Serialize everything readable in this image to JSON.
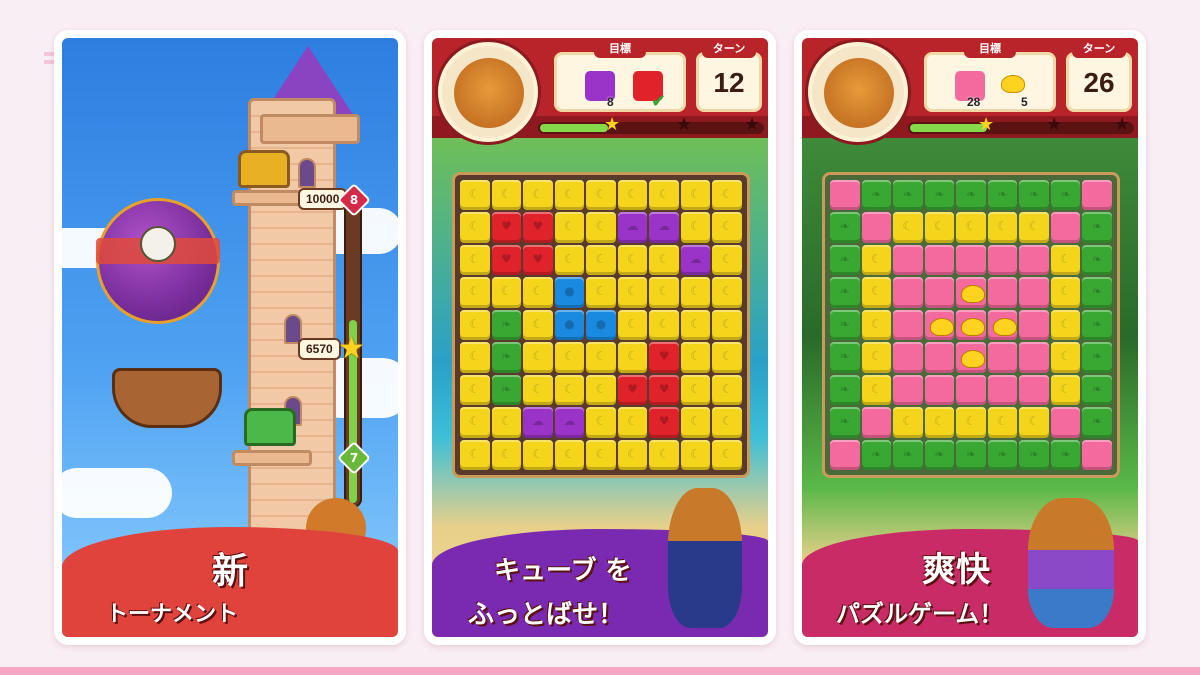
{
  "colors": {
    "page_bg": "#f8eef3",
    "card_frame": "#ffffff",
    "red_banner": "#e0423c",
    "purple_banner": "#7a2ab0",
    "pink_banner": "#c82b66",
    "header_red": "#b8242a"
  },
  "cards": [
    {
      "id": "tournament",
      "headline_line1": "新",
      "headline_line2": "トーナメント",
      "tower_scores": [
        "10000",
        "6570"
      ],
      "tier_badges": [
        "8",
        "7"
      ],
      "tournament_progress": 0.58
    },
    {
      "id": "cube-blast",
      "goal_label": "目標",
      "turns_label": "ターン",
      "turns_value": "12",
      "goals": [
        {
          "item": "purple-cube-icon",
          "count": "8"
        },
        {
          "item": "red-cube-icon",
          "count": ""
        }
      ],
      "goal_complete_icon": "check-icon",
      "star_progress": 0.3,
      "board": [
        "YYYYYYYYY",
        "YRRYYPPYY",
        "YRRYYYYPY",
        "YYYBYYYYY",
        "YGYBBYYYY",
        "YGYYYYRYY",
        "YGYYYRRYY",
        "YYPPYYRYY",
        "YYYYYYYYY"
      ],
      "headline_line1": "キューブ を",
      "headline_line2": "ふっとばせ！"
    },
    {
      "id": "puzzle",
      "goal_label": "目標",
      "turns_label": "ターン",
      "turns_value": "26",
      "goals": [
        {
          "item": "pink-cube-icon",
          "count": "28"
        },
        {
          "item": "duck-icon",
          "count": "5"
        }
      ],
      "star_progress": 0.34,
      "board": [
        "KGGGGGGGK",
        "GKYYYYYKG",
        "GYKKKKKYG",
        "GYKKDKKYG",
        "GYKDDDKYG",
        "GYKKDKKYG",
        "GYKKKKKYG",
        "GKYYYYYKG",
        "KGGGGGGGK"
      ],
      "headline_line1": "爽快",
      "headline_line2": "パズルゲーム！"
    }
  ]
}
